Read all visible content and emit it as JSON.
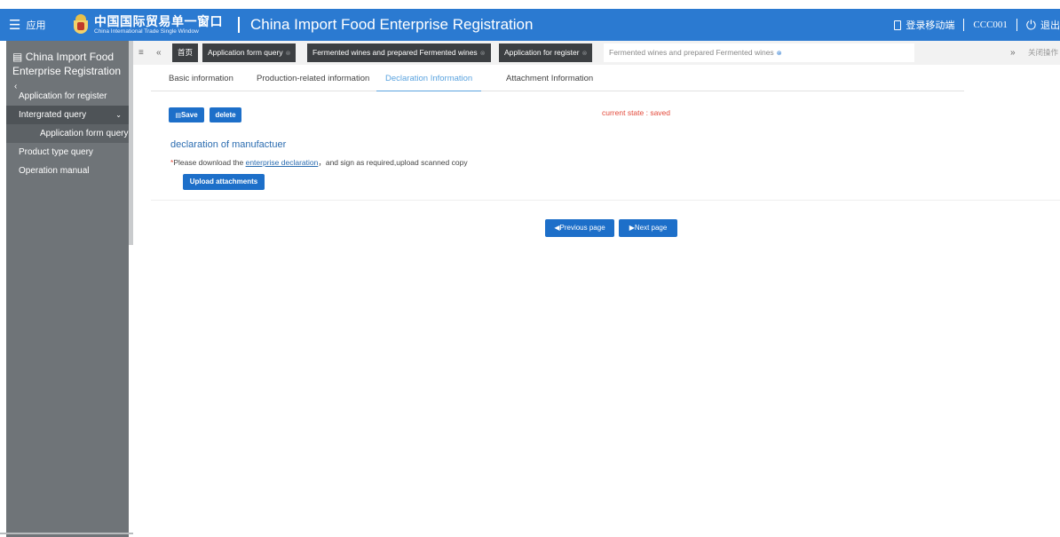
{
  "header": {
    "menu_label": "应用",
    "logo_cn": "中国国际贸易单一窗口",
    "logo_en": "China International Trade Single Window",
    "app_title": "China Import Food Enterprise Registration",
    "mobile_login": "登录移动端",
    "user": "CCC001",
    "logout": "退出",
    "color": "#2b7ad1"
  },
  "sidebar": {
    "title": "China Import Food Enterprise Registration",
    "items": [
      {
        "label": "Application for register"
      },
      {
        "label": "Intergrated query"
      },
      {
        "label": "Application form query"
      },
      {
        "label": "Product type query"
      },
      {
        "label": "Operation manual"
      }
    ]
  },
  "tabbar": {
    "home": "首页",
    "tabs": [
      {
        "label": "Application form query"
      },
      {
        "label": "Fermented wines and prepared Fermented wines"
      },
      {
        "label": "Application for register"
      },
      {
        "label": "Fermented wines and prepared Fermented wines"
      }
    ],
    "close_ops": "关闭操作"
  },
  "content_tabs": [
    {
      "label": "Basic information"
    },
    {
      "label": "Production-related information"
    },
    {
      "label": "Declaration Information"
    },
    {
      "label": "Attachment Information"
    }
  ],
  "form": {
    "save_label": "Save",
    "delete_label": "delete",
    "state": "current state : saved",
    "section_title": "declaration of manufactuer",
    "notice_star": "*",
    "notice_before": "Please download the ",
    "notice_link": "enterprise declaration",
    "notice_after": "，and sign as required,upload scanned copy",
    "upload_label": "Upload attachments"
  },
  "pager": {
    "prev_label": "Previous page",
    "next_label": "Next page"
  }
}
